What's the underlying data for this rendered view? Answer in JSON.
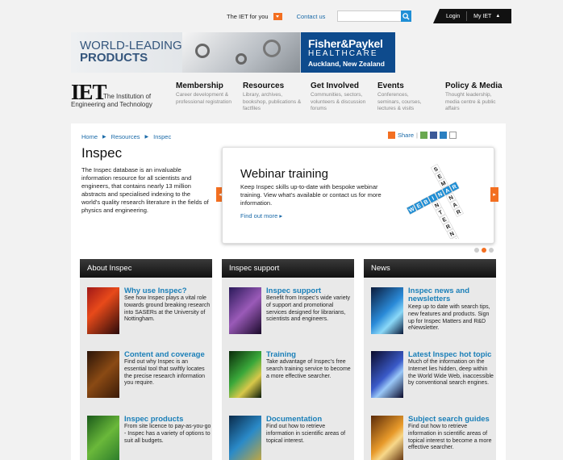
{
  "topbar": {
    "iet_for_you": "The IET for you",
    "contact": "Contact us",
    "search_placeholder": "",
    "login": "Login",
    "my_iet": "My IET",
    "my_iet_arrow": "▲"
  },
  "banner": {
    "line1": "WORLD-LEADING",
    "line2": "PRODUCTS",
    "brand": "Fisher&Paykel",
    "brand_sub": "HEALTHCARE",
    "location": "Auckland, New Zealand"
  },
  "logo": {
    "mark": "IET",
    "line1": "The Institution of",
    "line2": "Engineering and Technology"
  },
  "nav": [
    {
      "title": "Membership",
      "desc": "Career development & professional registration"
    },
    {
      "title": "Resources",
      "desc": "Library, archives, bookshop, publications & factfiles"
    },
    {
      "title": "Get Involved",
      "desc": "Communities, sectors, volunteers & discussion forums"
    },
    {
      "title": "Events",
      "desc": "Conferences, seminars, courses, lectures & visits"
    },
    {
      "title": "Policy & Media",
      "desc": "Thought leadership, media centre & public affairs"
    }
  ],
  "breadcrumb": [
    "Home",
    "Resources",
    "Inspec"
  ],
  "share_label": "Share",
  "page": {
    "title": "Inspec",
    "intro": "The Inspec database is an invaluable information resource for all scientists and engineers, that contains nearly 13 million abstracts and specialised indexing to the world's quality research literature in the fields of physics and engineering."
  },
  "slider": {
    "title": "Webinar training",
    "text": "Keep Inspec skills up-to-date with bespoke webinar training. View what's available or contact us for more information.",
    "link": "Find out more ▸",
    "prev": "◂",
    "next": "▸",
    "crossword": [
      "SEMINAR",
      "INTERNET",
      "WEBINAR"
    ]
  },
  "columns": [
    {
      "header": "About Inspec",
      "items": [
        {
          "title": "Why use Inspec?",
          "desc": "See how Inspec plays a vital role towards ground breaking research into SASERs at the University of Nottingham."
        },
        {
          "title": "Content and coverage",
          "desc": "Find out why Inspec is an essential tool that swiftly locates the precise research information you require."
        },
        {
          "title": "Inspec products",
          "desc": "From site licence to pay-as-you-go - Inspec has a variety of options to suit all budgets."
        }
      ]
    },
    {
      "header": "Inspec support",
      "items": [
        {
          "title": "Inspec support",
          "desc": "Benefit from Inspec's wide variety of support and promotional services designed for librarians, scientists and engineers."
        },
        {
          "title": "Training",
          "desc": "Take advantage of Inspec's free search training service to become a more effective searcher."
        },
        {
          "title": "Documentation",
          "desc": "Find out how to retrieve information in scientific areas of topical interest."
        }
      ]
    },
    {
      "header": "News",
      "items": [
        {
          "title": "Inspec news and newsletters",
          "desc": "Keep up to date with search tips, new features and products. Sign up for Inspec Matters and R&D eNewsletter."
        },
        {
          "title": "Latest Inspec hot topic",
          "desc": "Much of the information on the Internet lies hidden, deep within the World Wide Web, inaccessible by conventional search engines."
        },
        {
          "title": "Subject search guides",
          "desc": "Find out how to retrieve information in scientific areas of topical interest to become a more effective searcher."
        }
      ]
    }
  ],
  "colors": {
    "accent": "#f36f21",
    "link": "#1a6aa8",
    "item_title": "#1a7fb8"
  }
}
